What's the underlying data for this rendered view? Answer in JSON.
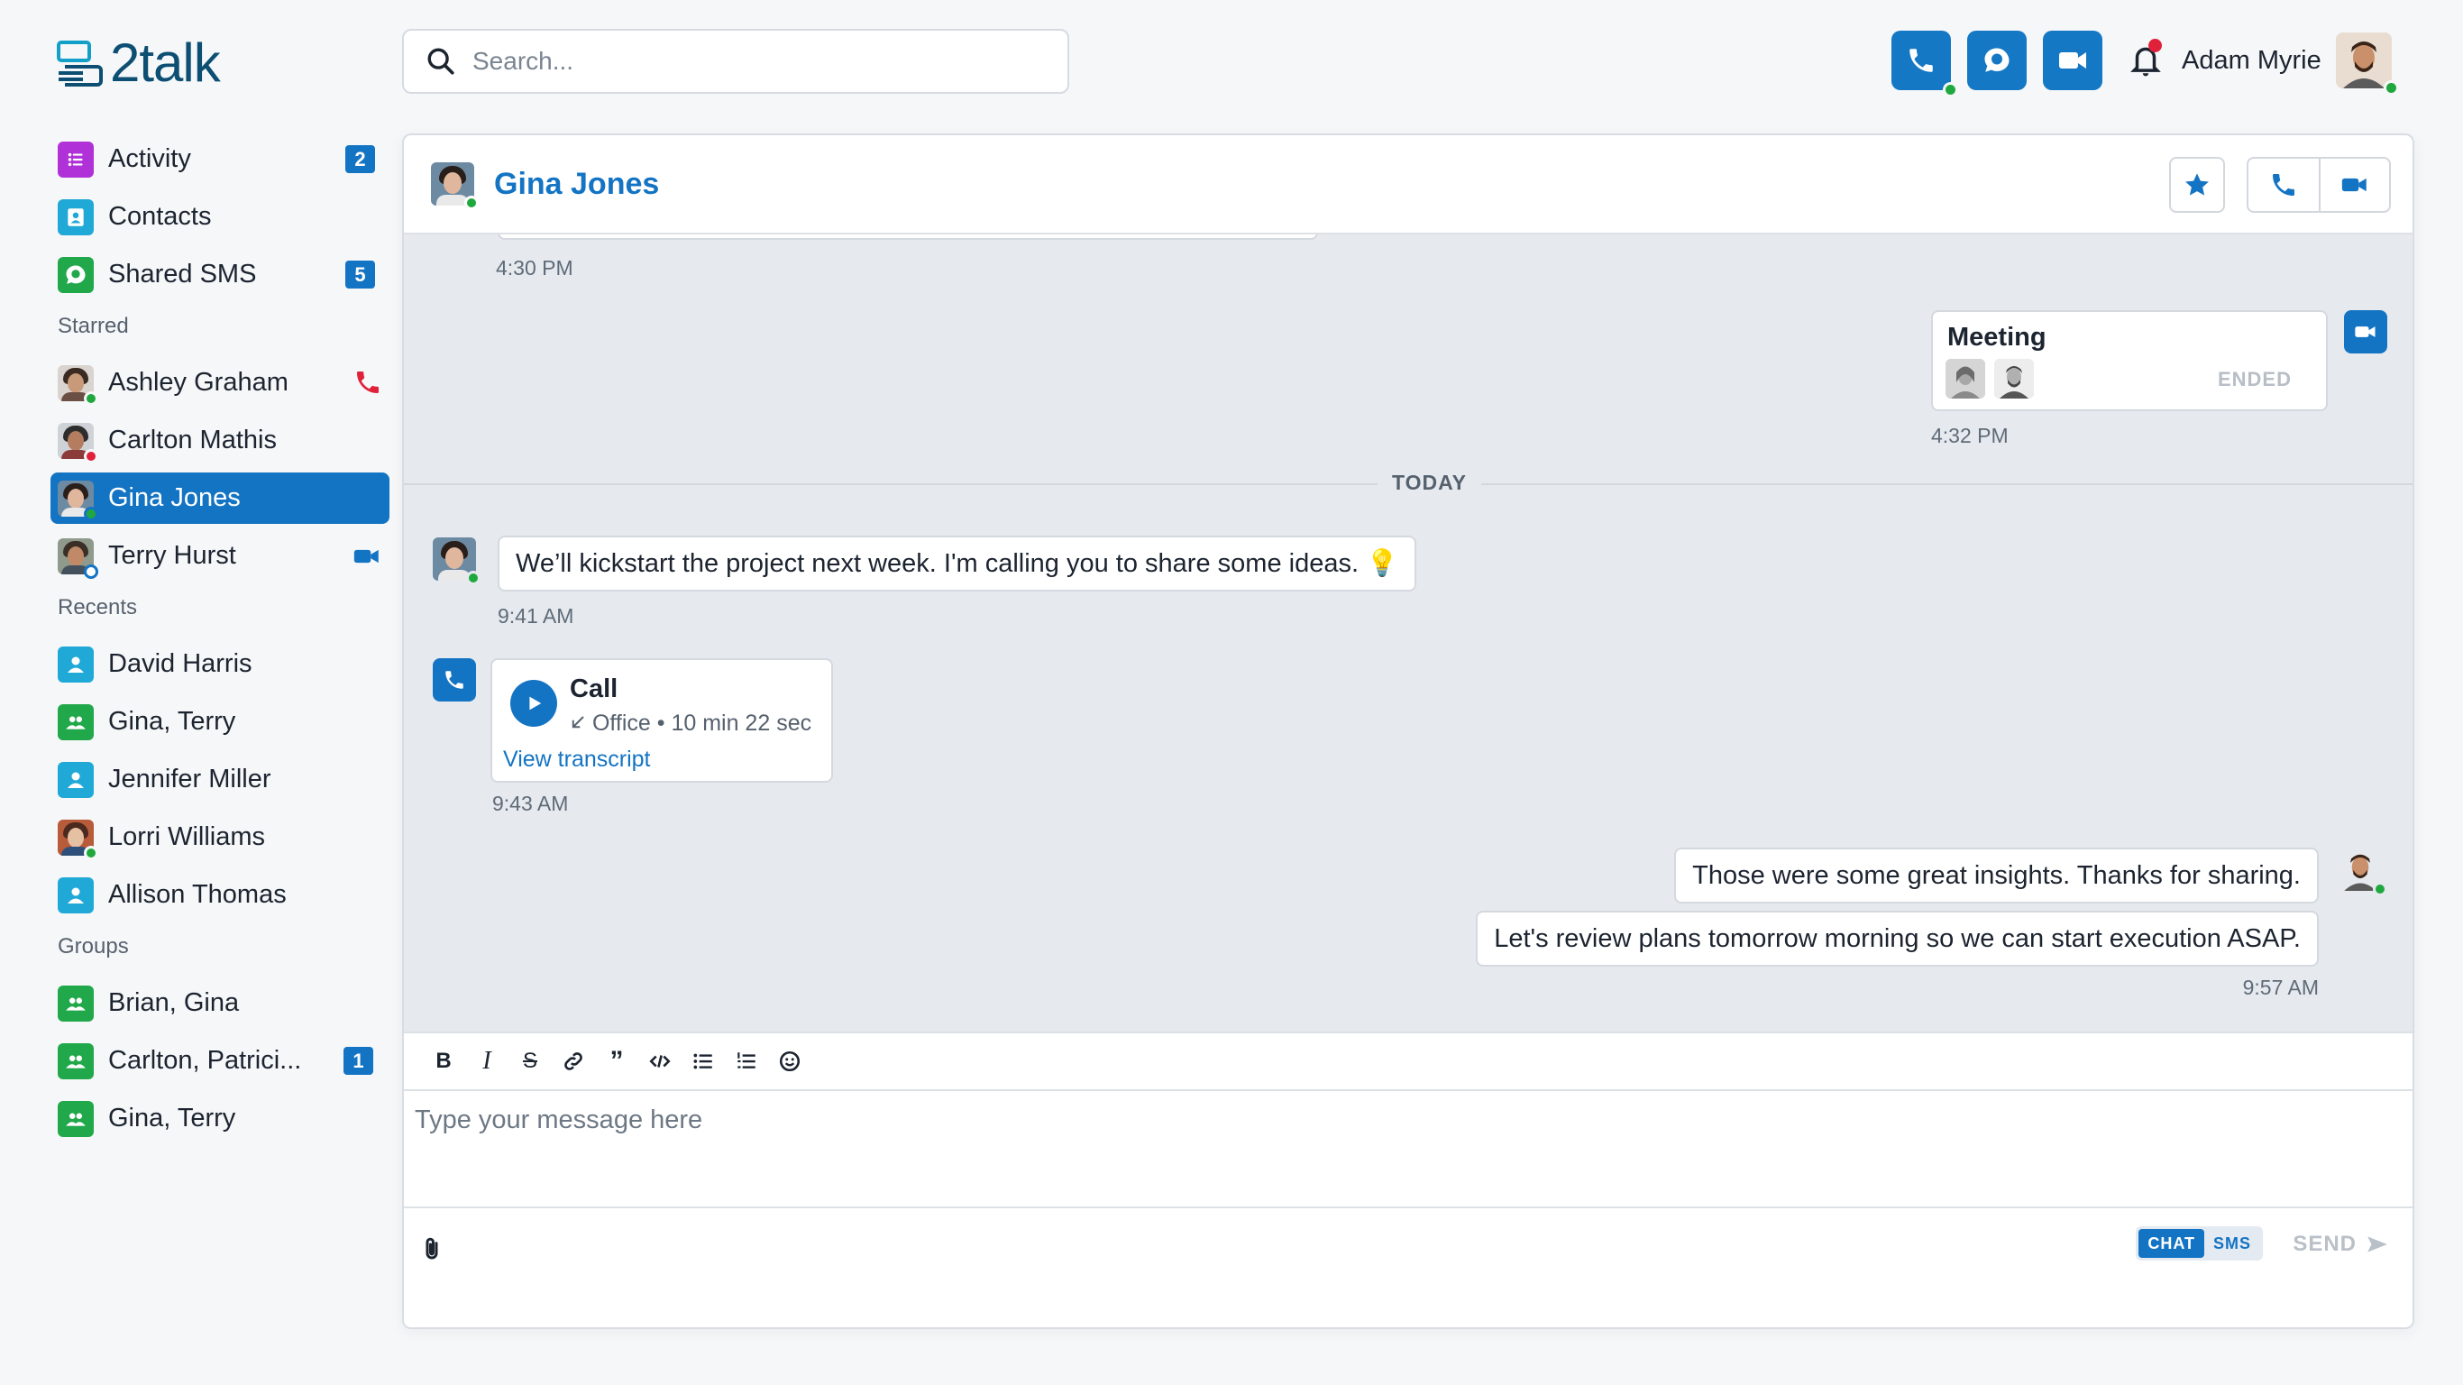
{
  "app": {
    "logo_text": "2talk"
  },
  "search": {
    "placeholder": "Search..."
  },
  "user": {
    "name": "Adam Myrie"
  },
  "colors": {
    "accent": "#1474c4",
    "online": "#1fa83d",
    "busy": "#e0213a"
  },
  "sidebar": {
    "nav": [
      {
        "label": "Activity",
        "badge": "2",
        "icon": "list-icon"
      },
      {
        "label": "Contacts",
        "badge": "",
        "icon": "contact-card-icon"
      },
      {
        "label": "Shared SMS",
        "badge": "5",
        "icon": "sms-icon"
      }
    ],
    "starred_heading": "Starred",
    "starred": [
      {
        "label": "Ashley Graham",
        "status": "online",
        "right_icon": "missed-call-icon"
      },
      {
        "label": "Carlton Mathis",
        "status": "busy",
        "right_icon": ""
      },
      {
        "label": "Gina Jones",
        "status": "online",
        "right_icon": "",
        "active": true
      },
      {
        "label": "Terry Hurst",
        "status": "away",
        "right_icon": "video-icon"
      }
    ],
    "recents_heading": "Recents",
    "recents": [
      {
        "label": "David Harris",
        "icon": "person-icon"
      },
      {
        "label": "Gina, Terry",
        "icon": "group-icon"
      },
      {
        "label": "Jennifer Miller",
        "icon": "person-icon"
      },
      {
        "label": "Lorri Williams",
        "icon": "avatar",
        "status": "online"
      },
      {
        "label": "Allison Thomas",
        "icon": "person-icon"
      }
    ],
    "groups_heading": "Groups",
    "groups": [
      {
        "label": "Brian, Gina",
        "badge": ""
      },
      {
        "label": "Carlton, Patrici...",
        "badge": "1"
      },
      {
        "label": "Gina, Terry",
        "badge": ""
      }
    ]
  },
  "conversation": {
    "title": "Gina Jones",
    "messages": {
      "first_time": "4:30 PM",
      "meeting_title": "Meeting",
      "meeting_status": "ENDED",
      "meeting_time": "4:32 PM",
      "divider": "TODAY",
      "msg1_text": "We’ll kickstart the project next week. I'm calling you to share some ideas. 💡",
      "msg1_time": "9:41 AM",
      "call_title": "Call",
      "call_source": "Office",
      "call_duration": "10 min 22 sec",
      "call_link": "View transcript",
      "call_time": "9:43 AM",
      "msg2_text": "Those were some great insights. Thanks for sharing.",
      "msg3_text": "Let's review plans tomorrow morning so we can start execution ASAP.",
      "msg23_time": "9:57 AM"
    }
  },
  "composer": {
    "placeholder": "Type your message here",
    "mode_chat": "CHAT",
    "mode_sms": "SMS",
    "send_label": "SEND"
  }
}
